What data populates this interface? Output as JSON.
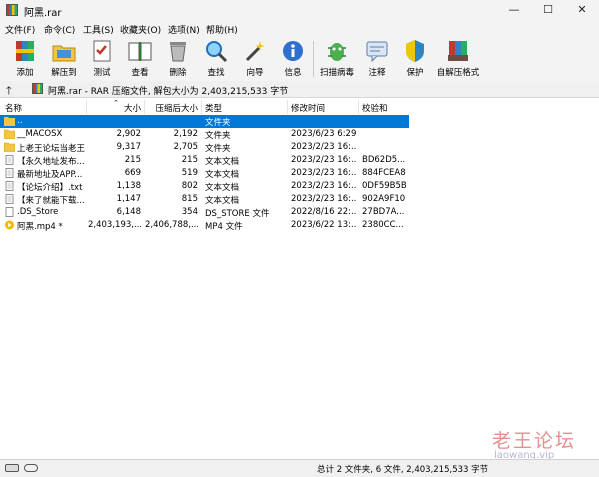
{
  "window": {
    "title": "阿黑.rar",
    "minimize": "—",
    "maximize": "☐",
    "close": "✕"
  },
  "menu": [
    "文件(F)",
    "命令(C)",
    "工具(S)",
    "收藏夹(O)",
    "选项(N)",
    "帮助(H)"
  ],
  "toolbar": [
    {
      "label": "添加",
      "icon": "add-archive-icon"
    },
    {
      "label": "解压到",
      "icon": "extract-to-icon"
    },
    {
      "label": "测试",
      "icon": "test-icon"
    },
    {
      "label": "查看",
      "icon": "view-icon"
    },
    {
      "label": "删除",
      "icon": "delete-icon"
    },
    {
      "label": "查找",
      "icon": "find-icon"
    },
    {
      "label": "向导",
      "icon": "wizard-icon"
    },
    {
      "label": "信息",
      "icon": "info-icon"
    },
    {
      "label": "扫描病毒",
      "icon": "scan-virus-icon"
    },
    {
      "label": "注释",
      "icon": "comment-icon"
    },
    {
      "label": "保护",
      "icon": "protect-icon"
    },
    {
      "label": "自解压格式",
      "icon": "sfx-icon"
    }
  ],
  "address": {
    "up": "🡑",
    "text": "阿黑.rar - RAR 压缩文件, 解包大小为 2,403,215,533 字节"
  },
  "columns": [
    "名称",
    "大小",
    "压缩后大小",
    "类型",
    "修改时间",
    "校验和"
  ],
  "rows": [
    {
      "name": "..",
      "size": "",
      "packed": "",
      "type": "文件夹",
      "modified": "",
      "crc": "",
      "icon": "parent-folder-icon",
      "selected": true
    },
    {
      "name": "__MACOSX",
      "size": "2,902",
      "packed": "2,192",
      "type": "文件夹",
      "modified": "2023/6/23 6:29",
      "crc": "",
      "icon": "folder-icon",
      "selected": false
    },
    {
      "name": "上老王论坛当老王",
      "size": "9,317",
      "packed": "2,705",
      "type": "文件夹",
      "modified": "2023/2/23 16:...",
      "crc": "",
      "icon": "folder-icon",
      "selected": false
    },
    {
      "name": "【永久地址发布...",
      "size": "215",
      "packed": "215",
      "type": "文本文档",
      "modified": "2023/2/23 16:...",
      "crc": "BD62D5...",
      "icon": "text-file-icon",
      "selected": false
    },
    {
      "name": "最新地址及APP...",
      "size": "669",
      "packed": "519",
      "type": "文本文档",
      "modified": "2023/2/23 16:...",
      "crc": "884FCEA8",
      "icon": "text-file-icon",
      "selected": false
    },
    {
      "name": "【论坛介绍】.txt",
      "size": "1,138",
      "packed": "802",
      "type": "文本文档",
      "modified": "2023/2/23 16:...",
      "crc": "0DF59B5B",
      "icon": "text-file-icon",
      "selected": false
    },
    {
      "name": "【来了就能下载...",
      "size": "1,147",
      "packed": "815",
      "type": "文本文档",
      "modified": "2023/2/23 16:...",
      "crc": "902A9F10",
      "icon": "text-file-icon",
      "selected": false
    },
    {
      "name": ".DS_Store",
      "size": "6,148",
      "packed": "354",
      "type": "DS_STORE 文件",
      "modified": "2022/8/16 22:...",
      "crc": "27BD7A...",
      "icon": "generic-file-icon",
      "selected": false
    },
    {
      "name": "阿黑.mp4 *",
      "size": "2,403,193,...",
      "packed": "2,406,788,...",
      "type": "MP4 文件",
      "modified": "2023/6/22 13:...",
      "crc": "2380CC...",
      "icon": "video-file-icon",
      "selected": false
    }
  ],
  "status": {
    "text": "总计 2 文件夹, 6 文件, 2,403,215,533 字节"
  },
  "watermark": {
    "cn": "老王论坛",
    "en": "laowang.vip"
  },
  "colors": {
    "selection": "#0078d7",
    "folder": "#f5c542",
    "watermark": "#e06a6a"
  }
}
